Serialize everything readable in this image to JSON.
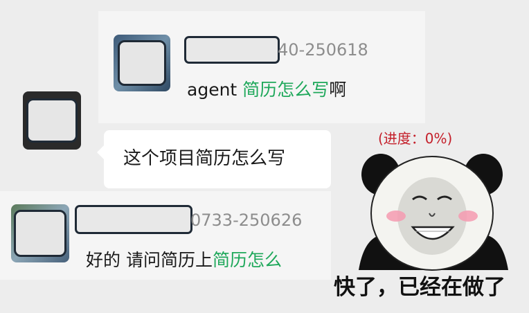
{
  "messages": [
    {
      "handle_suffix": "40-250618",
      "text_plain": "agent ",
      "text_highlight": "简历怎么写",
      "text_tail": "啊"
    },
    {
      "text": "这个项目简历怎么写"
    },
    {
      "handle_suffix": "0733-250626",
      "text_plain": "好的 请问简历上",
      "text_highlight": "简历怎么"
    }
  ],
  "meme": {
    "progress": "(进度：0%)",
    "caption": "快了，已经在做了"
  },
  "colors": {
    "highlight": "#1ea85a",
    "progress": "#c41f2a",
    "card_bg": "#f5f5f5",
    "bubble_bg": "#ffffff",
    "page_bg": "#ededed"
  }
}
